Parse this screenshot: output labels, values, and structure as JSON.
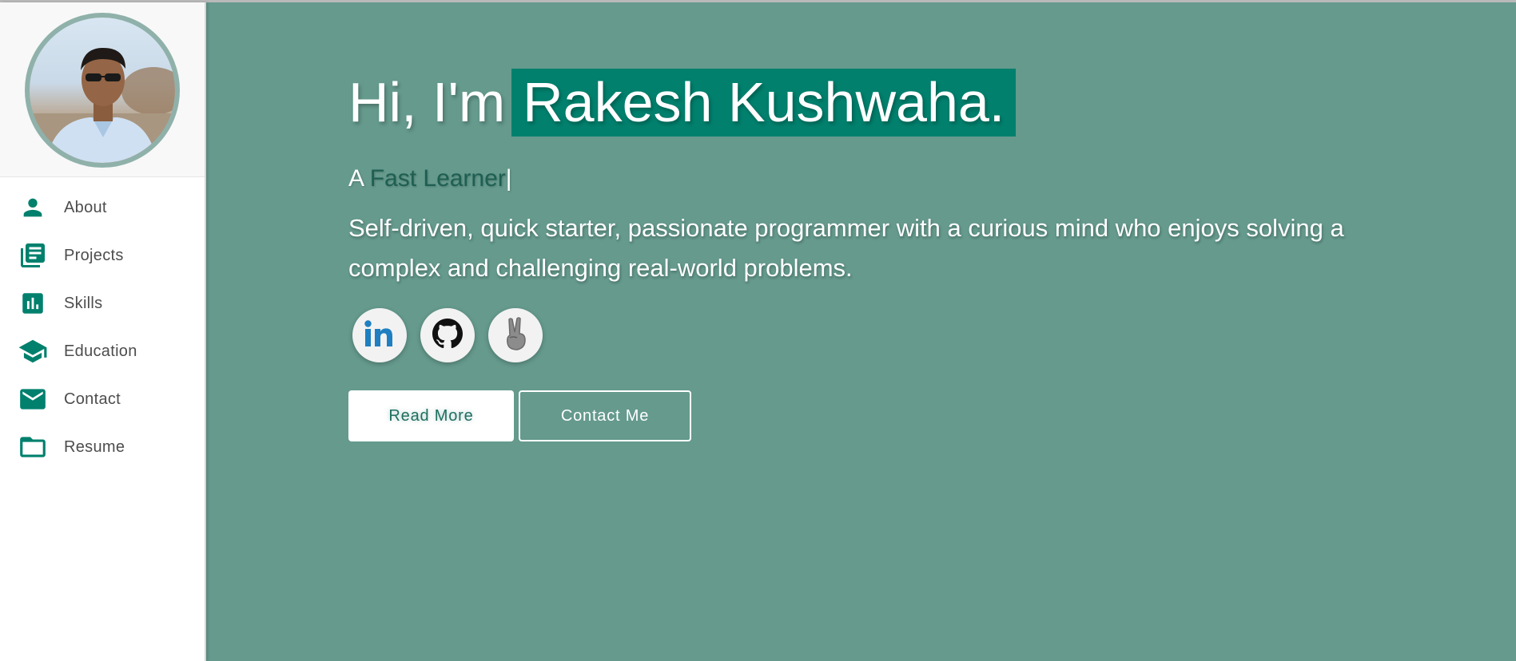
{
  "sidebar": {
    "avatar_alt": "",
    "items": [
      {
        "label": "About",
        "icon": "person-icon"
      },
      {
        "label": "Projects",
        "icon": "library-books-icon"
      },
      {
        "label": "Skills",
        "icon": "bar-chart-icon"
      },
      {
        "label": "Education",
        "icon": "school-icon"
      },
      {
        "label": "Contact",
        "icon": "mail-icon"
      },
      {
        "label": "Resume",
        "icon": "folder-icon"
      }
    ]
  },
  "hero": {
    "greeting": "Hi, I'm",
    "name": "Rakesh Kushwaha.",
    "tagline_prefix": "A",
    "tagline_role": "Fast Learner",
    "tagline_cursor": "|",
    "description": "Self-driven, quick starter, passionate programmer with a curious mind who enjoys solving a complex and challenging real-world problems.",
    "socials": [
      {
        "name": "linkedin",
        "icon": "linkedin-icon"
      },
      {
        "name": "github",
        "icon": "github-icon"
      },
      {
        "name": "peace",
        "icon": "peace-hand-icon"
      }
    ],
    "read_more_label": "Read More",
    "contact_label": "Contact Me"
  },
  "colors": {
    "main_bg": "#659a8d",
    "accent": "#00806d",
    "nav_icon": "#00806d"
  }
}
